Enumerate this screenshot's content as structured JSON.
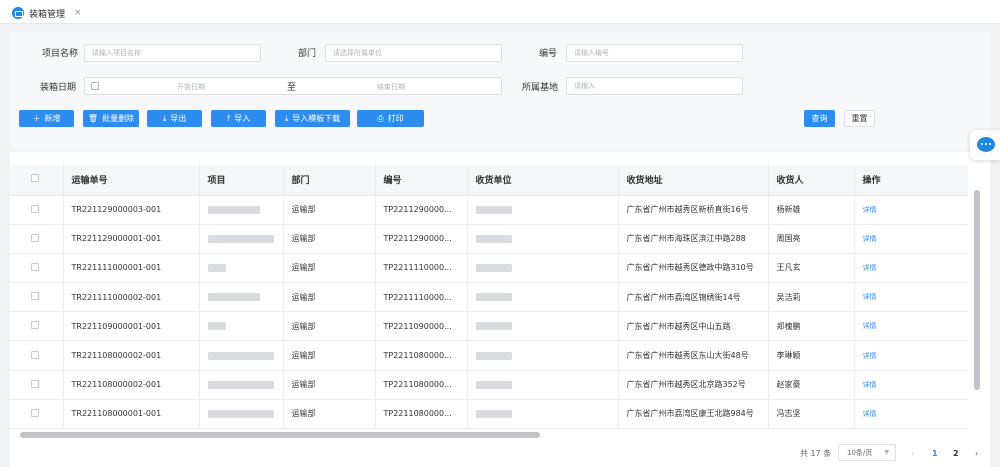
{
  "tab": {
    "title": "装箱管理",
    "close": "×"
  },
  "filters": {
    "project_label": "项目名称",
    "project_placeholder": "请输入项目名称",
    "dept_label": "部门",
    "dept_placeholder": "请选择所属单位",
    "code_label": "编号",
    "code_placeholder": "请输入编号",
    "date_label": "装箱日期",
    "date_start": "开始日期",
    "date_sep": "至",
    "date_end": "结束日期",
    "base_label": "所属基地",
    "base_placeholder": "请输入"
  },
  "toolbar": {
    "add": "新增",
    "batch_delete": "批量删除",
    "export": "导出",
    "import": "导入",
    "import_template": "导入模板下载",
    "print": "打印",
    "query": "查询",
    "reset": "重置"
  },
  "table": {
    "headers": [
      "运输单号",
      "项目",
      "部门",
      "编号",
      "收货单位",
      "收货地址",
      "收货人",
      "操作"
    ],
    "rows": [
      {
        "order": "TR221129000003-001",
        "dept": "运输部",
        "code": "TP2211290000...",
        "address": "广东省广州市越秀区新桥直街16号",
        "receiver": "杨新雄",
        "action": "详情"
      },
      {
        "order": "TR221129000001-001",
        "dept": "运输部",
        "code": "TP2211290000...",
        "address": "广东省广州市海珠区滨江中路288",
        "receiver": "周国亮",
        "action": "详情"
      },
      {
        "order": "TR221111000001-001",
        "dept": "运输部",
        "code": "TP2211110000...",
        "address": "广东省广州市越秀区德政中路310号",
        "receiver": "王凡玄",
        "action": "详情"
      },
      {
        "order": "TR221111000002-001",
        "dept": "运输部",
        "code": "TP2211110000...",
        "address": "广东省广州市荔湾区锦绣街14号",
        "receiver": "吴洁莉",
        "action": "详情"
      },
      {
        "order": "TR221109000001-001",
        "dept": "运输部",
        "code": "TP2211090000...",
        "address": "广东省广州市越秀区中山五路",
        "receiver": "郑槐鹏",
        "action": "详情"
      },
      {
        "order": "TR221108000002-001",
        "dept": "运输部",
        "code": "TP2211080000...",
        "address": "广东省广州市越秀区东山大街48号",
        "receiver": "李琳颖",
        "action": "详情"
      },
      {
        "order": "TR221108000002-001",
        "dept": "运输部",
        "code": "TP2211080000...",
        "address": "广东省广州市越秀区北京路352号",
        "receiver": "赵家豪",
        "action": "详情"
      },
      {
        "order": "TR221108000001-001",
        "dept": "运输部",
        "code": "TP2211080000...",
        "address": "广东省广州市荔湾区康王北路984号",
        "receiver": "冯志坚",
        "action": "详情"
      }
    ]
  },
  "pagination": {
    "total": "共 17 条",
    "page_size": "10条/页",
    "prev": "‹",
    "page1": "1",
    "page2": "2",
    "next": "›"
  }
}
